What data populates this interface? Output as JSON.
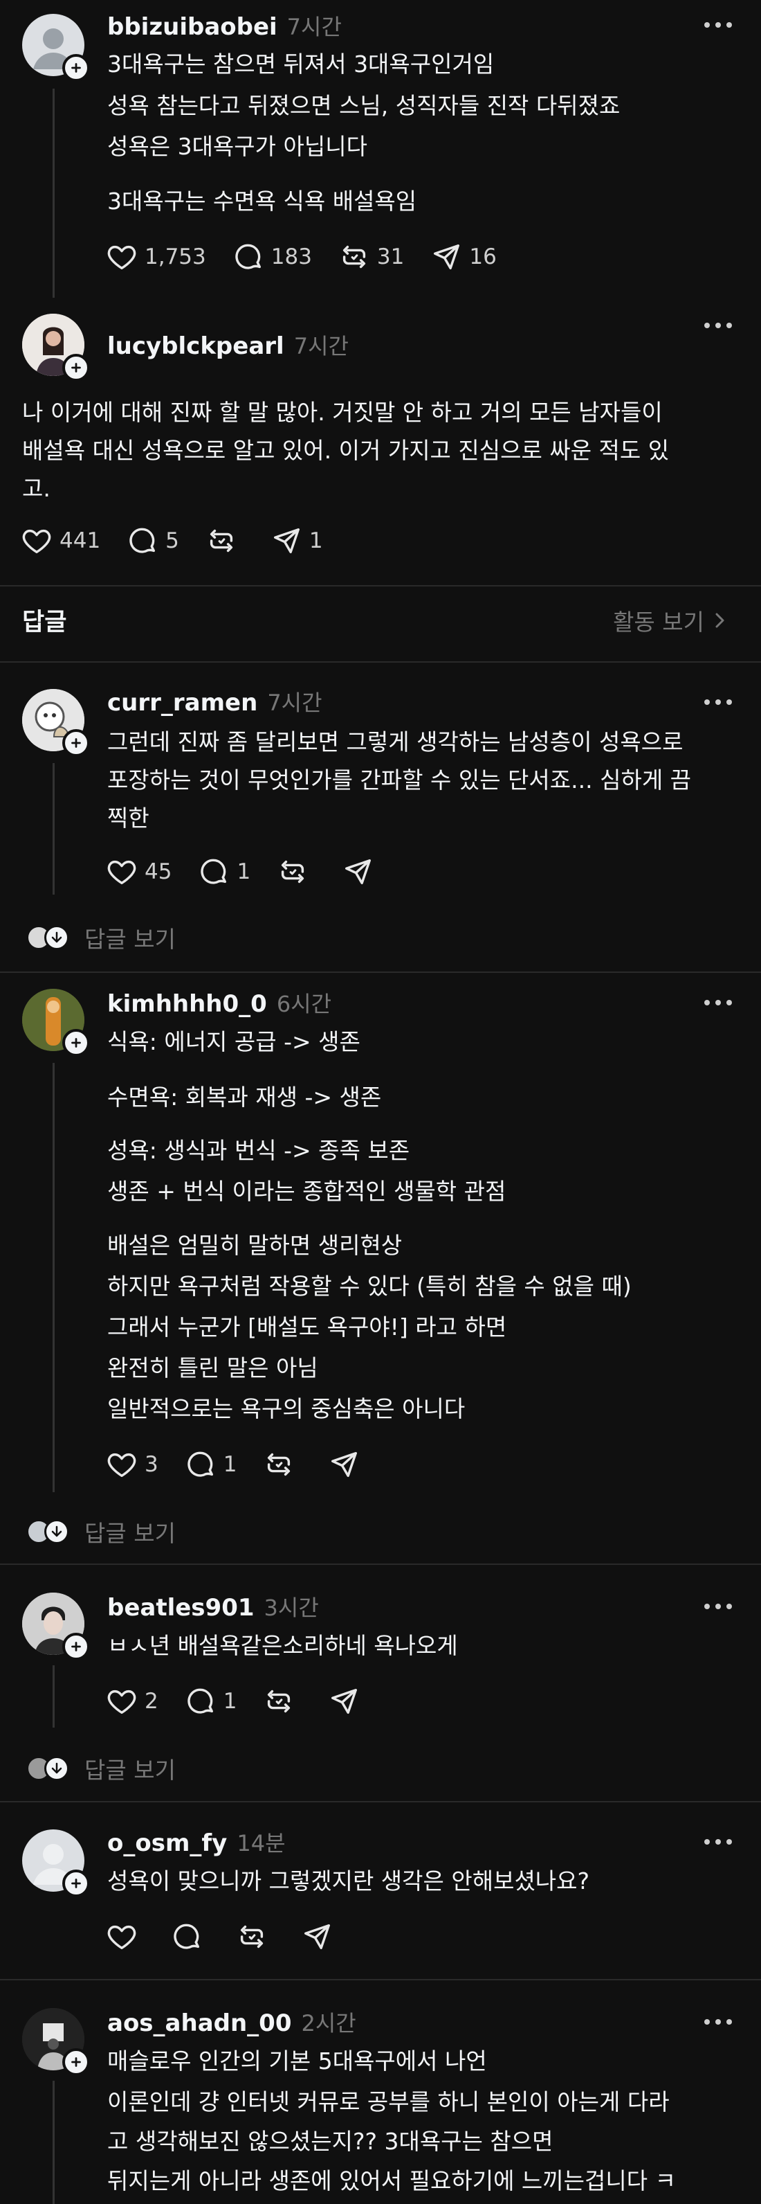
{
  "icons": {
    "more": "more-icon",
    "like": "heart-icon",
    "comment": "comment-icon",
    "repost": "repost-icon",
    "share": "share-icon"
  },
  "post1": {
    "username": "bbizuibaobei",
    "time": "7시간",
    "lines": [
      "3대욕구는 참으면 뒤져서 3대욕구인거임",
      "성욕 참는다고 뒤졌으면 스님, 성직자들 진작 다뒤졌죠",
      "성욕은 3대욕구가 아닙니다",
      "3대욕구는 수면욕 식욕 배설욕임"
    ],
    "likes": "1,753",
    "comments": "183",
    "reposts": "31",
    "shares": "16"
  },
  "post2": {
    "username": "lucyblckpearl",
    "time": "7시간",
    "lines": [
      "나 이거에 대해 진짜 할 말 많아. 거짓말 안 하고 거의 모든 남자들이",
      "배설욕 대신 성욕으로 알고 있어. 이거 가지고 진심으로 싸운 적도 있",
      "고."
    ],
    "likes": "441",
    "comments": "5",
    "shares": "1"
  },
  "section": {
    "title": "답글",
    "activity": "활동 보기"
  },
  "reply1": {
    "username": "curr_ramen",
    "time": "7시간",
    "lines": [
      "그런데 진짜 좀 달리보면 그렇게 생각하는 남성층이 성욕으로",
      "포장하는 것이 무엇인가를 간파할 수 있는 단서죠... 심하게 끔",
      "찍한"
    ],
    "likes": "45",
    "comments": "1",
    "view_replies": "답글 보기"
  },
  "reply2": {
    "username": "kimhhhh0_0",
    "time": "6시간",
    "lines": [
      "식욕: 에너지 공급 -> 생존",
      "수면욕: 회복과 재생 -> 생존",
      "성욕: 생식과 번식 -> 종족 보존",
      "생존 + 번식 이라는 종합적인 생물학 관점",
      "배설은 엄밀히 말하면 생리현상",
      "하지만 욕구처럼 작용할 수 있다 (특히 참을 수 없을 때)",
      "그래서 누군가 [배설도 욕구야!] 라고 하면",
      "완전히 틀린 말은 아님",
      "일반적으로는 욕구의 중심축은 아니다"
    ],
    "likes": "3",
    "comments": "1",
    "view_replies": "답글 보기"
  },
  "reply3": {
    "username": "beatles901",
    "time": "3시간",
    "lines": [
      "ㅂㅅ년 배설욕같은소리하네  욕나오게"
    ],
    "likes": "2",
    "comments": "1",
    "view_replies": "답글 보기"
  },
  "reply4": {
    "username": "o_osm_fy",
    "time": "14분",
    "lines": [
      "성욕이 맞으니까 그렇겠지란 생각은 안해보셨나요?"
    ]
  },
  "reply5": {
    "username": "aos_ahadn_00",
    "time": "2시간",
    "lines": [
      "매슬로우 인간의 기본 5대욕구에서 나언",
      "이론인데 걍 인터넷 커뮤로 공부를 하니 본인이 아는게 다라",
      "고 생각해보진 않으셨는지?? 3대욕구는 참으면",
      "뒤지는게 아니라 생존에 있어서 필요하기에 느끼는겁니다 ㅋ"
    ]
  }
}
